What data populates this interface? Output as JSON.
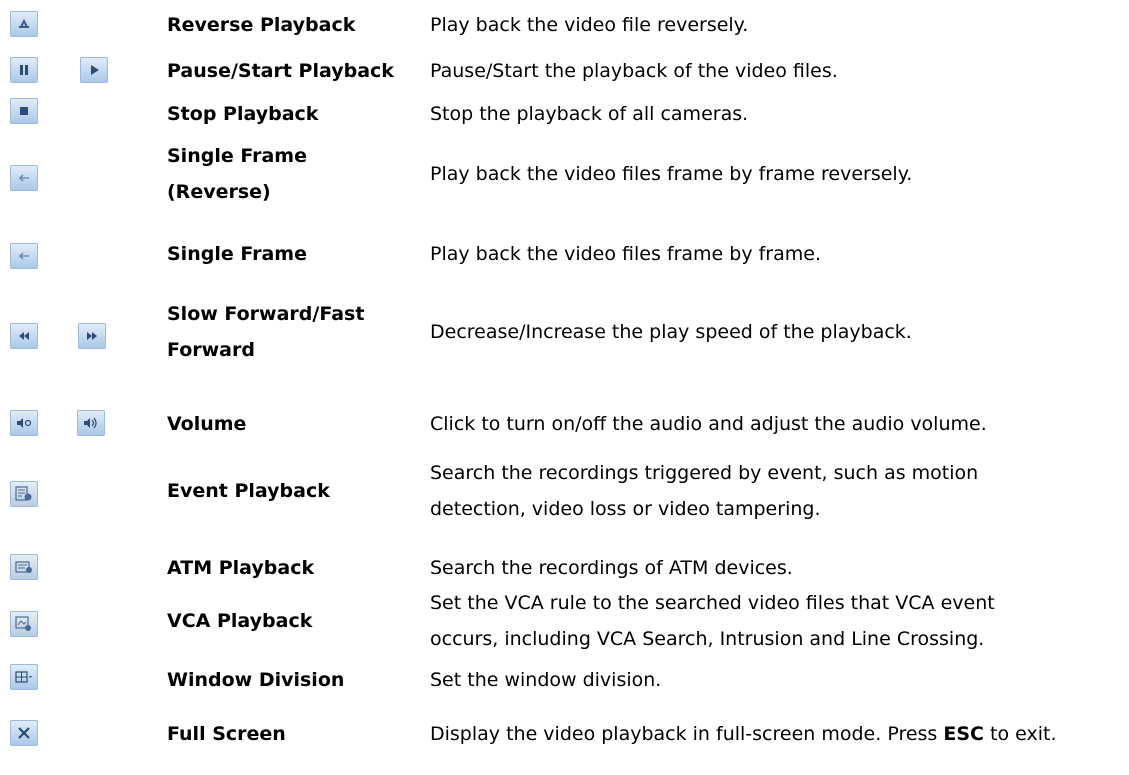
{
  "rows": [
    {
      "name": "Reverse Playback",
      "desc": "Play back the video file reversely.",
      "icons": [
        "reverse-playback-icon"
      ]
    },
    {
      "name": "Pause/Start Playback",
      "desc": "Pause/Start the playback of the video files.",
      "icons": [
        "pause-icon",
        "play-icon"
      ]
    },
    {
      "name": "Stop Playback",
      "desc": "Stop the playback of all cameras.",
      "icons": [
        "stop-icon"
      ]
    },
    {
      "name_lines": [
        "Single Frame",
        "(Reverse)"
      ],
      "desc": "Play back the video files frame by frame reversely.",
      "icons": [
        "single-frame-reverse-icon"
      ]
    },
    {
      "name": "Single Frame",
      "desc": "Play back the video files frame by frame.",
      "icons": [
        "single-frame-icon"
      ]
    },
    {
      "name_lines": [
        "Slow Forward/Fast",
        "Forward"
      ],
      "desc": "Decrease/Increase the play speed of the playback.",
      "icons": [
        "slow-forward-icon",
        "fast-forward-icon"
      ]
    },
    {
      "name": "Volume",
      "desc": "Click to turn on/off the audio and adjust the audio volume.",
      "icons": [
        "volume-off-icon",
        "volume-on-icon"
      ]
    },
    {
      "name": "Event Playback",
      "desc_lines": [
        "Search the recordings triggered by event, such as motion",
        "detection, video loss or video tampering."
      ],
      "icons": [
        "event-playback-icon"
      ]
    },
    {
      "name": "ATM Playback",
      "desc": "Search the recordings of ATM devices.",
      "icons": [
        "atm-playback-icon"
      ]
    },
    {
      "name": "VCA Playback",
      "desc_lines": [
        "Set the VCA rule to the searched video files that VCA event",
        "occurs, including VCA Search, Intrusion and Line Crossing."
      ],
      "icons": [
        "vca-playback-icon"
      ]
    },
    {
      "name": "Window Division",
      "desc": "Set the window division.",
      "icons": [
        "window-division-icon"
      ]
    },
    {
      "name": "Full Screen",
      "desc_pre": "Display the video playback in full-screen mode. Press ",
      "desc_key": "ESC",
      "desc_post": " to exit.",
      "icons": [
        "full-screen-icon"
      ]
    }
  ]
}
